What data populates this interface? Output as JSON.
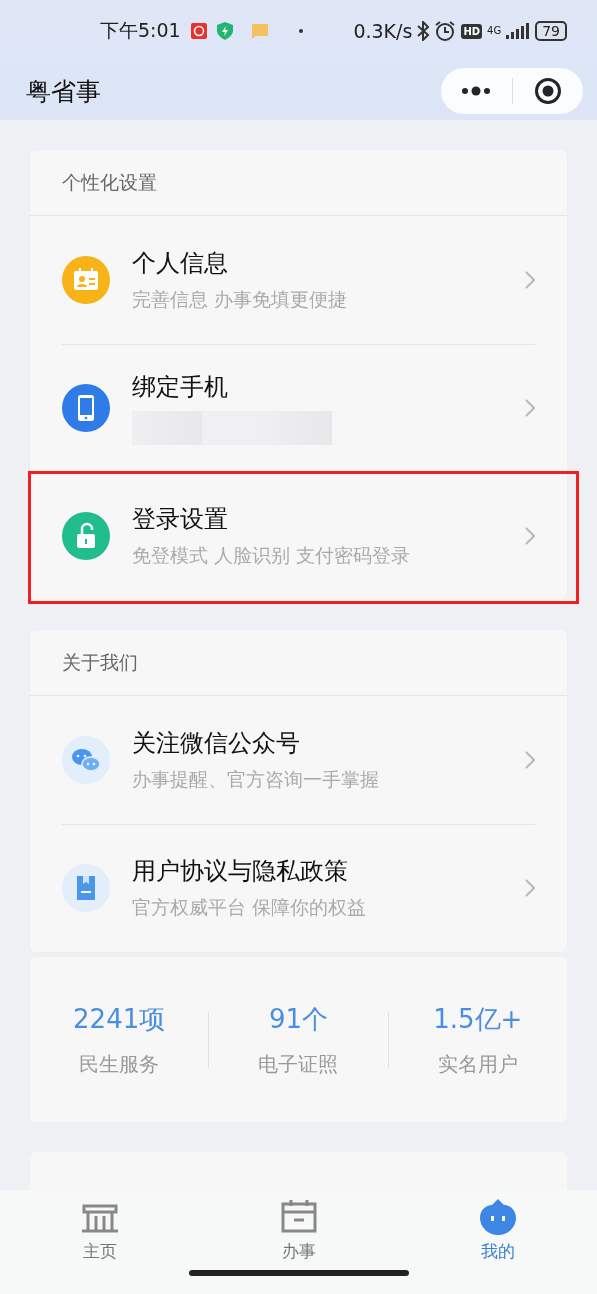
{
  "status_bar": {
    "time": "下午5:01",
    "net_speed": "0.3K/s",
    "hd": "HD",
    "network": "4G",
    "battery": "79"
  },
  "nav": {
    "title": "粤省事"
  },
  "sections": [
    {
      "header": "个性化设置",
      "items": [
        {
          "title": "个人信息",
          "subtitle": "完善信息 办事免填更便捷",
          "kind": "id-card",
          "redacted": false,
          "highlighted": false
        },
        {
          "title": "绑定手机",
          "kind": "phone",
          "redacted": true,
          "highlighted": false
        },
        {
          "title": "登录设置",
          "subtitle": "免登模式 人脸识别 支付密码登录",
          "kind": "lock",
          "redacted": false,
          "highlighted": true
        }
      ]
    },
    {
      "header": "关于我们",
      "items": [
        {
          "title": "关注微信公众号",
          "subtitle": "办事提醒、官方咨询一手掌握",
          "kind": "chat",
          "redacted": false,
          "highlighted": false
        },
        {
          "title": "用户协议与隐私政策",
          "subtitle": "官方权威平台 保障你的权益",
          "kind": "document",
          "redacted": false,
          "highlighted": false
        }
      ]
    }
  ],
  "stats": [
    {
      "value": "2241项",
      "label": "民生服务"
    },
    {
      "value": "91个",
      "label": "电子证照"
    },
    {
      "value": "1.5亿+",
      "label": "实名用户"
    }
  ],
  "tabs": [
    {
      "label": "主页",
      "kind": "home",
      "selected": false
    },
    {
      "label": "办事",
      "kind": "calendar",
      "selected": false
    },
    {
      "label": "我的",
      "kind": "mascot",
      "selected": true
    }
  ]
}
